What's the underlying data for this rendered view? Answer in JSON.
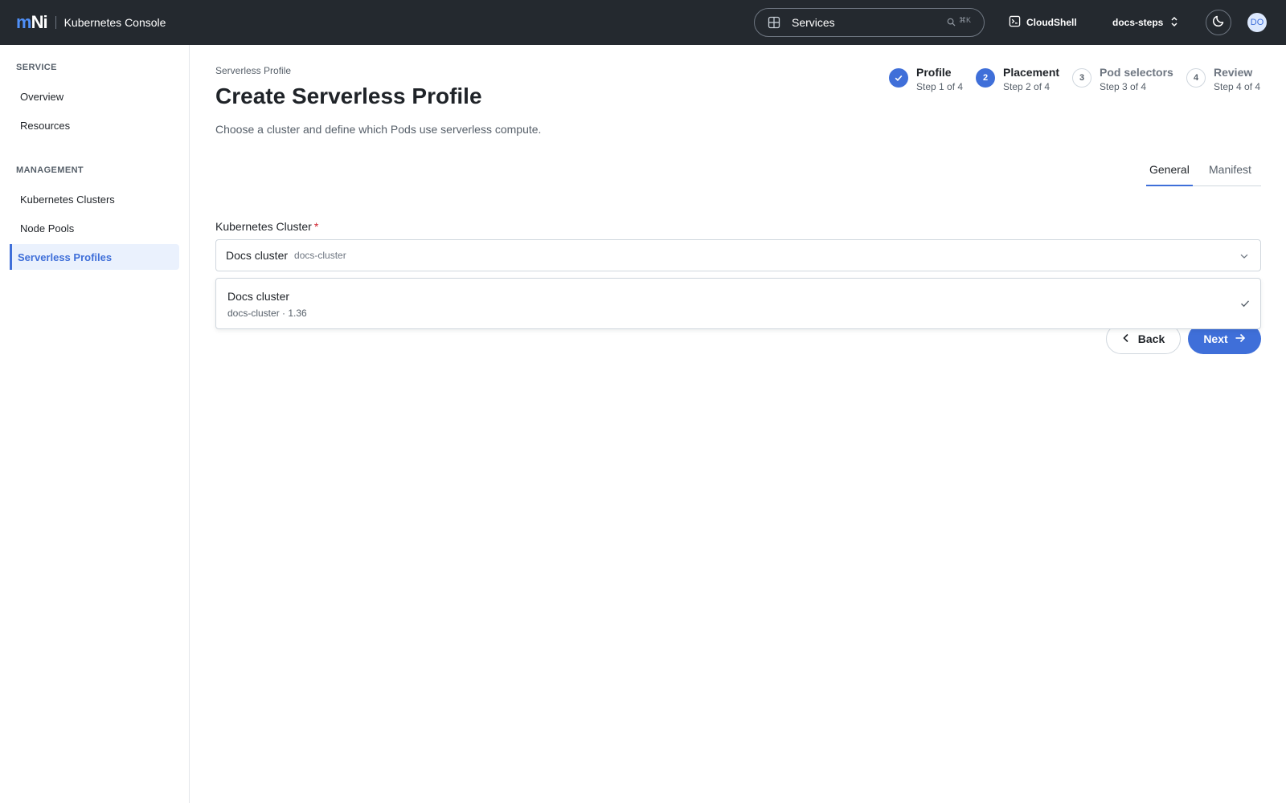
{
  "topbar": {
    "logo": {
      "m": "m",
      "n": "N",
      "i": "i"
    },
    "app_title": "Kubernetes Console",
    "search_label": "Services",
    "search_shortcut": "⌘K",
    "cloudshell_label": "CloudShell",
    "project_label": "docs-steps",
    "avatar_initials": "DO"
  },
  "sidebar": {
    "sections": [
      {
        "title": "SERVICE",
        "items": [
          "Overview",
          "Resources"
        ]
      },
      {
        "title": "MANAGEMENT",
        "items": [
          "Kubernetes Clusters",
          "Node Pools",
          "Serverless Profiles"
        ]
      }
    ],
    "active_item": "Serverless Profiles"
  },
  "page": {
    "breadcrumb": "Serverless Profile",
    "title": "Create Serverless Profile",
    "subtitle": "Choose a cluster and define which Pods use serverless compute."
  },
  "steps": [
    {
      "title": "Profile",
      "sub": "Step 1 of 4",
      "state": "done",
      "number": "1"
    },
    {
      "title": "Placement",
      "sub": "Step 2 of 4",
      "state": "current",
      "number": "2"
    },
    {
      "title": "Pod selectors",
      "sub": "Step 3 of 4",
      "state": "todo",
      "number": "3"
    },
    {
      "title": "Review",
      "sub": "Step 4 of 4",
      "state": "todo",
      "number": "4"
    }
  ],
  "tabs": {
    "general": "General",
    "manifest": "Manifest",
    "active": "General"
  },
  "form": {
    "cluster_label": "Kubernetes Cluster",
    "required_mark": "*",
    "selected_name": "Docs cluster",
    "selected_id": "docs-cluster",
    "options": [
      {
        "name": "Docs cluster",
        "meta": "docs-cluster · 1.36",
        "selected": true
      }
    ]
  },
  "actions": {
    "back": "Back",
    "next": "Next"
  },
  "colors": {
    "topbar_bg": "#24292f",
    "accent": "#3f6fd9",
    "active_nav_bg": "#eaf1fd",
    "required": "#cf222e"
  },
  "icons": {
    "grid": "grid-icon",
    "search": "search-icon",
    "terminal": "terminal-icon",
    "updown": "chevron-up-down-icon",
    "moon": "moon-icon",
    "check": "check-icon",
    "chevron_down": "chevron-down-icon",
    "chevron_left": "chevron-left-icon",
    "arrow_right": "arrow-right-icon"
  }
}
